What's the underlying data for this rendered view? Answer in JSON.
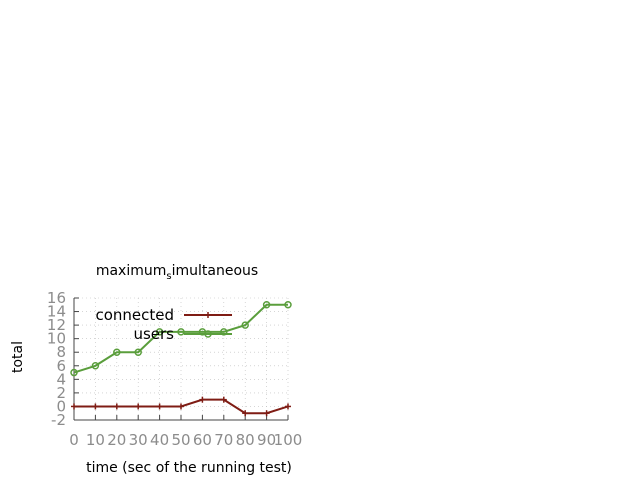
{
  "chart_data": {
    "type": "line",
    "title": "maximum_simultaneous",
    "xlabel": "time (sec of the running test)",
    "ylabel": "total",
    "xlim": [
      0,
      100
    ],
    "ylim": [
      -2,
      16
    ],
    "xticks": [
      "0",
      "10",
      "20",
      "30",
      "40",
      "50",
      "60",
      "70",
      "80",
      "90",
      "100"
    ],
    "yticks": [
      "-2",
      "0",
      "2",
      "4",
      "6",
      "8",
      "10",
      "12",
      "14",
      "16"
    ],
    "grid": true,
    "legend_position": "top-left",
    "series": [
      {
        "name": "connected",
        "color": "#7f1c14",
        "marker": "plus",
        "x": [
          0,
          10,
          20,
          30,
          40,
          50,
          60,
          70,
          80,
          90,
          100
        ],
        "y": [
          0,
          0,
          0,
          0,
          0,
          0,
          1,
          1,
          -1,
          -1,
          0
        ]
      },
      {
        "name": "users",
        "color": "#5a9e3c",
        "marker": "circle",
        "x": [
          0,
          10,
          20,
          30,
          40,
          50,
          60,
          70,
          80,
          90,
          100
        ],
        "y": [
          5,
          6,
          8,
          8,
          11,
          11,
          11,
          11,
          12,
          15,
          15
        ]
      }
    ]
  }
}
